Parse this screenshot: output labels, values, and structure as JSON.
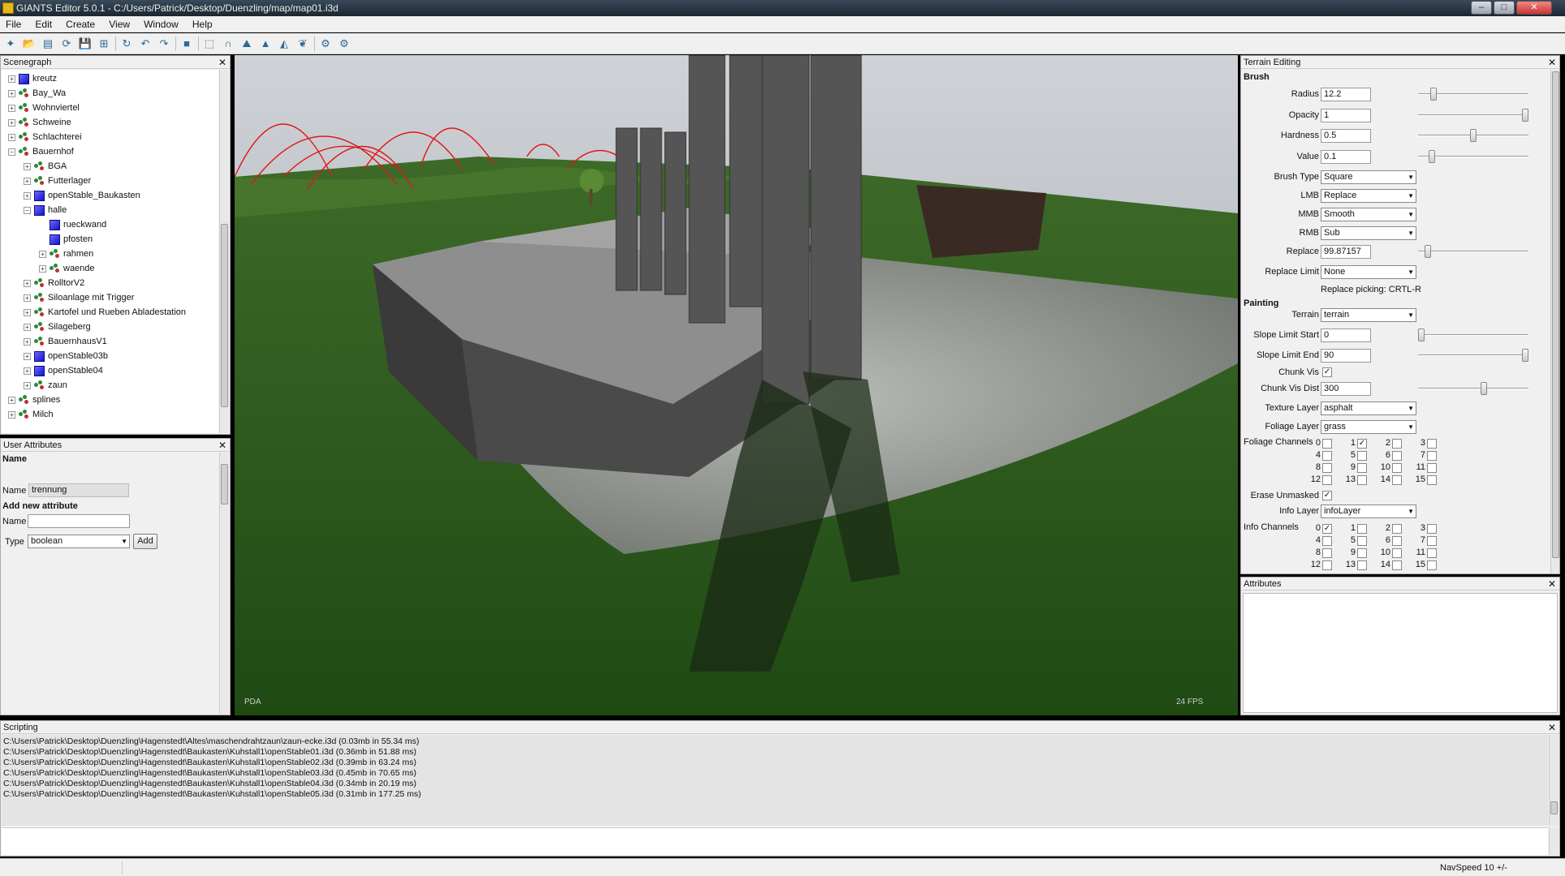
{
  "window": {
    "title": "GIANTS Editor 5.0.1 - C:/Users/Patrick/Desktop/Duenzling/map/map01.i3d",
    "minimize": "–",
    "maximize": "□",
    "close": "✕"
  },
  "menu": [
    "File",
    "Edit",
    "Create",
    "View",
    "Window",
    "Help"
  ],
  "toolbar": [
    {
      "name": "new-scene-icon",
      "glyph": "✦"
    },
    {
      "name": "open-icon",
      "glyph": "📂"
    },
    {
      "name": "save-list-icon",
      "glyph": "▤"
    },
    {
      "name": "reload-icon",
      "glyph": "⟳"
    },
    {
      "name": "save-icon",
      "glyph": "💾"
    },
    {
      "name": "save-all-icon",
      "glyph": "⊞"
    },
    {
      "name": "refresh-icon",
      "glyph": "↻"
    },
    {
      "name": "undo-icon",
      "glyph": "↶"
    },
    {
      "name": "redo-icon",
      "glyph": "↷"
    },
    {
      "name": "stop-icon",
      "glyph": "■"
    },
    {
      "name": "select-tool-icon",
      "glyph": "⬚"
    },
    {
      "name": "magnet-icon",
      "glyph": "∩"
    },
    {
      "name": "terrain-raise-icon",
      "glyph": "⛰"
    },
    {
      "name": "terrain-paint-icon",
      "glyph": "▲"
    },
    {
      "name": "terrain-smooth-icon",
      "glyph": "◭"
    },
    {
      "name": "foliage-icon",
      "glyph": "❦"
    },
    {
      "name": "settings-icon",
      "glyph": "⚙"
    },
    {
      "name": "settings-alt-icon",
      "glyph": "⚙"
    }
  ],
  "scenegraph": {
    "title": "Scenegraph",
    "close": "✕",
    "items": [
      {
        "label": "kreutz",
        "depth": 0,
        "icon": "cube",
        "expander": "+"
      },
      {
        "label": "Bay_Wa",
        "depth": 0,
        "icon": "group",
        "expander": "+"
      },
      {
        "label": "Wohnviertel",
        "depth": 0,
        "icon": "group",
        "expander": "+"
      },
      {
        "label": "Schweine",
        "depth": 0,
        "icon": "group",
        "expander": "+"
      },
      {
        "label": "Schlachterei",
        "depth": 0,
        "icon": "group",
        "expander": "+"
      },
      {
        "label": "Bauernhof",
        "depth": 0,
        "icon": "group",
        "expander": "−"
      },
      {
        "label": "BGA",
        "depth": 1,
        "icon": "group",
        "expander": "+"
      },
      {
        "label": "Futterlager",
        "depth": 1,
        "icon": "group",
        "expander": "+"
      },
      {
        "label": "openStable_Baukasten",
        "depth": 1,
        "icon": "cube",
        "expander": "+"
      },
      {
        "label": "halle",
        "depth": 1,
        "icon": "cube",
        "expander": "−"
      },
      {
        "label": "rueckwand",
        "depth": 2,
        "icon": "cube",
        "expander": ""
      },
      {
        "label": "pfosten",
        "depth": 2,
        "icon": "cube",
        "expander": ""
      },
      {
        "label": "rahmen",
        "depth": 2,
        "icon": "group",
        "expander": "+"
      },
      {
        "label": "waende",
        "depth": 2,
        "icon": "group",
        "expander": "+"
      },
      {
        "label": "RolltorV2",
        "depth": 1,
        "icon": "group",
        "expander": "+"
      },
      {
        "label": "Siloanlage mit Trigger",
        "depth": 1,
        "icon": "group",
        "expander": "+"
      },
      {
        "label": "Kartofel und Rueben Abladestation",
        "depth": 1,
        "icon": "group",
        "expander": "+"
      },
      {
        "label": "Silageberg",
        "depth": 1,
        "icon": "group",
        "expander": "+"
      },
      {
        "label": "BauernhausV1",
        "depth": 1,
        "icon": "group",
        "expander": "+"
      },
      {
        "label": "openStable03b",
        "depth": 1,
        "icon": "cube",
        "expander": "+"
      },
      {
        "label": "openStable04",
        "depth": 1,
        "icon": "cube",
        "expander": "+"
      },
      {
        "label": "zaun",
        "depth": 1,
        "icon": "group",
        "expander": "+"
      },
      {
        "label": "splines",
        "depth": 0,
        "icon": "group",
        "expander": "+"
      },
      {
        "label": "Milch",
        "depth": 0,
        "icon": "group",
        "expander": "+"
      }
    ]
  },
  "user_attributes": {
    "title": "User Attributes",
    "close": "✕",
    "section_name": "Name",
    "name_label": "Name",
    "name_value": "trennung",
    "add_section": "Add new attribute",
    "new_name_label": "Name",
    "new_name_value": "",
    "type_label": "Type",
    "type_value": "boolean",
    "add_button": "Add"
  },
  "viewport": {
    "label_left": "PDA",
    "fps": "24 FPS"
  },
  "terrain_editing": {
    "title": "Terrain Editing",
    "close": "✕",
    "brush_section": "Brush",
    "radius_label": "Radius",
    "radius": "12.2",
    "radius_slider": 0.12,
    "opacity_label": "Opacity",
    "opacity": "1",
    "opacity_slider": 1.0,
    "hardness_label": "Hardness",
    "hardness": "0.5",
    "hardness_slider": 0.5,
    "value_label": "Value",
    "value": "0.1",
    "value_slider": 0.1,
    "brush_type_label": "Brush Type",
    "brush_type": "Square",
    "lmb_label": "LMB",
    "lmb": "Replace",
    "mmb_label": "MMB",
    "mmb": "Smooth",
    "rmb_label": "RMB",
    "rmb": "Sub",
    "replace_label": "Replace",
    "replace": "99.87157",
    "replace_slider": 0.06,
    "replace_limit_label": "Replace Limit",
    "replace_limit": "None",
    "replace_picking": "Replace picking: CRTL-R",
    "painting_section": "Painting",
    "terrain_label": "Terrain",
    "terrain": "terrain",
    "slope_start_label": "Slope Limit Start",
    "slope_start": "0",
    "slope_start_slider": 0.0,
    "slope_end_label": "Slope Limit End",
    "slope_end": "90",
    "slope_end_slider": 1.0,
    "chunk_vis_label": "Chunk Vis",
    "chunk_vis": true,
    "chunk_vis_dist_label": "Chunk Vis Dist",
    "chunk_vis_dist": "300",
    "chunk_vis_dist_slider": 0.6,
    "texture_layer_label": "Texture Layer",
    "texture_layer": "asphalt",
    "foliage_layer_label": "Foliage Layer",
    "foliage_layer": "grass",
    "foliage_channels_label": "Foliage Channels",
    "foliage_channels": [
      {
        "n": "0",
        "on": false
      },
      {
        "n": "1",
        "on": true
      },
      {
        "n": "2",
        "on": false
      },
      {
        "n": "3",
        "on": false
      },
      {
        "n": "4",
        "on": false
      },
      {
        "n": "5",
        "on": false
      },
      {
        "n": "6",
        "on": false
      },
      {
        "n": "7",
        "on": false
      },
      {
        "n": "8",
        "on": false
      },
      {
        "n": "9",
        "on": false
      },
      {
        "n": "10",
        "on": false
      },
      {
        "n": "11",
        "on": false
      },
      {
        "n": "12",
        "on": false
      },
      {
        "n": "13",
        "on": false
      },
      {
        "n": "14",
        "on": false
      },
      {
        "n": "15",
        "on": false
      }
    ],
    "erase_unmasked_label": "Erase Unmasked",
    "erase_unmasked": true,
    "info_layer_label": "Info Layer",
    "info_layer": "infoLayer",
    "info_channels_label": "Info Channels",
    "info_channels": [
      {
        "n": "0",
        "on": true
      },
      {
        "n": "1",
        "on": false
      },
      {
        "n": "2",
        "on": false
      },
      {
        "n": "3",
        "on": false
      },
      {
        "n": "4",
        "on": false
      },
      {
        "n": "5",
        "on": false
      },
      {
        "n": "6",
        "on": false
      },
      {
        "n": "7",
        "on": false
      },
      {
        "n": "8",
        "on": false
      },
      {
        "n": "9",
        "on": false
      },
      {
        "n": "10",
        "on": false
      },
      {
        "n": "11",
        "on": false
      },
      {
        "n": "12",
        "on": false
      },
      {
        "n": "13",
        "on": false
      },
      {
        "n": "14",
        "on": false
      },
      {
        "n": "15",
        "on": false
      }
    ]
  },
  "attributes": {
    "title": "Attributes",
    "close": "✕"
  },
  "scripting": {
    "title": "Scripting",
    "close": "✕",
    "lines": [
      "C:\\Users\\Patrick\\Desktop\\Duenzling\\Hagenstedt\\Altes\\maschendrahtzaun\\zaun-ecke.i3d (0.03mb in 55.34 ms)",
      "C:\\Users\\Patrick\\Desktop\\Duenzling\\Hagenstedt\\Baukasten\\Kuhstall1\\openStable01.i3d (0.36mb in 51.88 ms)",
      "C:\\Users\\Patrick\\Desktop\\Duenzling\\Hagenstedt\\Baukasten\\Kuhstall1\\openStable02.i3d (0.39mb in 63.24 ms)",
      "C:\\Users\\Patrick\\Desktop\\Duenzling\\Hagenstedt\\Baukasten\\Kuhstall1\\openStable03.i3d (0.45mb in 70.65 ms)",
      "C:\\Users\\Patrick\\Desktop\\Duenzling\\Hagenstedt\\Baukasten\\Kuhstall1\\openStable04.i3d (0.34mb in 20.19 ms)",
      "C:\\Users\\Patrick\\Desktop\\Duenzling\\Hagenstedt\\Baukasten\\Kuhstall1\\openStable05.i3d (0.31mb in 177.25 ms)"
    ]
  },
  "status": {
    "navspeed": "NavSpeed 10 +/-"
  }
}
